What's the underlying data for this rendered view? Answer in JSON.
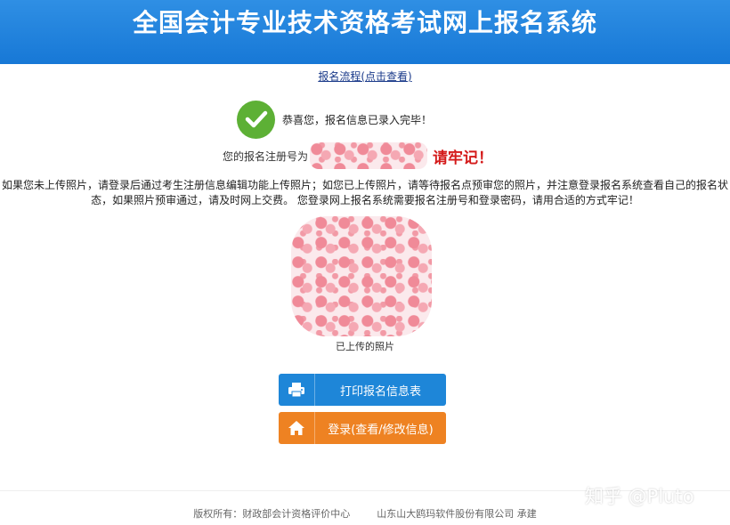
{
  "header": {
    "title": "全国会计专业技术资格考试网上报名系统"
  },
  "flow_link": "报名流程(点击查看)",
  "success": {
    "icon": "checkmark-icon",
    "text": "恭喜您，报名信息已录入完毕！"
  },
  "registration": {
    "label": "您的报名注册号为",
    "remember": "请牢记！"
  },
  "notice": "如果您未上传照片，请登录后通过考生注册信息编辑功能上传照片；如您已上传照片，请等待报名点预审您的照片，并注意登录报名系统查看自己的报名状态，如果照片预审通过，请及时网上交费。 您登录网上报名系统需要报名注册号和登录密码，请用合适的方式牢记！",
  "photo": {
    "caption": "已上传的照片"
  },
  "buttons": {
    "print": {
      "label": "打印报名信息表",
      "icon": "printer-icon",
      "color": "#1e86d8"
    },
    "login": {
      "label": "登录(查看/修改信息)",
      "icon": "home-icon",
      "color": "#ee8222"
    }
  },
  "footer": {
    "copyright": "版权所有：财政部会计资格评价中心",
    "vendor": "山东山大鸥玛软件股份有限公司 承建"
  },
  "watermark": "知乎 @Pluto",
  "colors": {
    "header": "#1e86d8",
    "success_green": "#5db035",
    "remember_red": "#d41a1a"
  }
}
